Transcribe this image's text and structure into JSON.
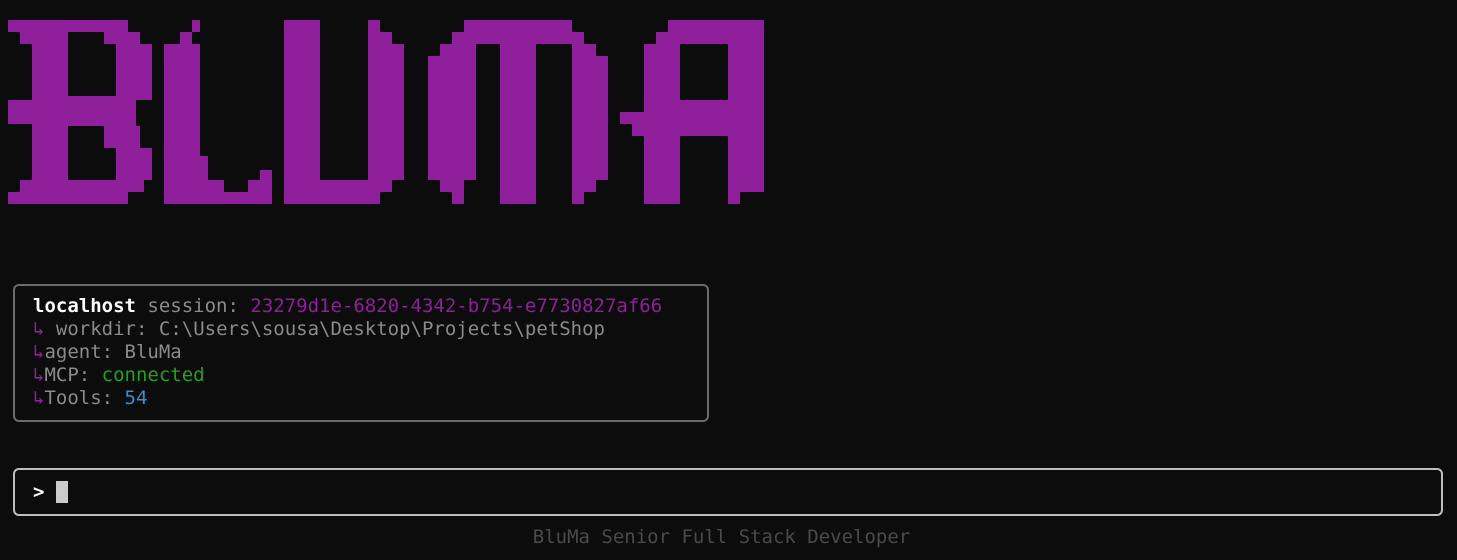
{
  "app": {
    "logo_text": "BLUMA",
    "brand_color": "#8f1f9b"
  },
  "info": {
    "host": "localhost",
    "session_label": "session:",
    "session_id": "23279d1e-6820-4342-b754-e7730827af66",
    "arrow_glyph": "↳",
    "workdir_label": "workdir:",
    "workdir_value": "C:\\Users\\sousa\\Desktop\\Projects\\petShop",
    "agent_label": "agent:",
    "agent_value": "BluMa",
    "mcp_label": "MCP:",
    "mcp_value": "connected",
    "tools_label": "Tools:",
    "tools_value": "54"
  },
  "prompt": {
    "symbol": ">",
    "value": ""
  },
  "footer": {
    "text": "BluMa Senior Full Stack Developer"
  },
  "colors": {
    "background": "#0c0c0c",
    "connected": "#1fa21f",
    "tools": "#3b8ed6",
    "muted": "#8a8a8a"
  }
}
